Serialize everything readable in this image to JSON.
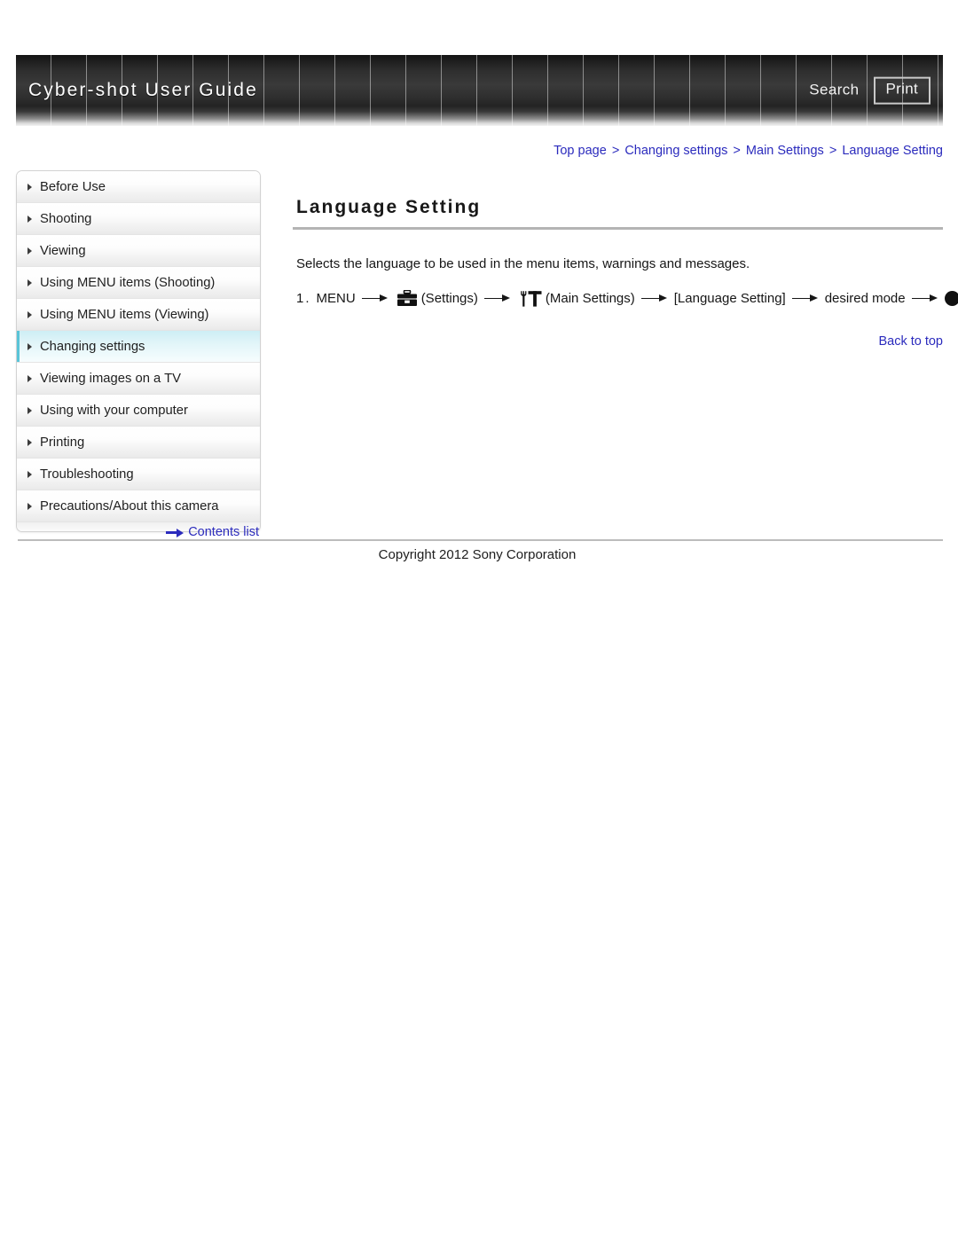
{
  "header": {
    "title": "Cyber-shot User Guide",
    "search_label": "Search",
    "print_label": "Print"
  },
  "breadcrumb": {
    "items": [
      "Top page",
      "Changing settings",
      "Main Settings",
      "Language Setting"
    ],
    "separator": ">"
  },
  "sidebar": {
    "items": [
      {
        "label": "Before Use",
        "active": false
      },
      {
        "label": "Shooting",
        "active": false
      },
      {
        "label": "Viewing",
        "active": false
      },
      {
        "label": "Using MENU items (Shooting)",
        "active": false
      },
      {
        "label": "Using MENU items (Viewing)",
        "active": false
      },
      {
        "label": "Changing settings",
        "active": true
      },
      {
        "label": "Viewing images on a TV",
        "active": false
      },
      {
        "label": "Using with your computer",
        "active": false
      },
      {
        "label": "Printing",
        "active": false
      },
      {
        "label": "Troubleshooting",
        "active": false
      },
      {
        "label": "Precautions/About this camera",
        "active": false
      }
    ],
    "contents_list_label": "Contents list"
  },
  "main": {
    "title": "Language Setting",
    "description": "Selects the language to be used in the menu items, warnings and messages.",
    "step": {
      "number": "1.",
      "menu_label": "MENU",
      "settings_label": "(Settings)",
      "main_settings_label": "(Main Settings)",
      "language_setting_label": "[Language Setting]",
      "desired_mode_label": "desired mode"
    },
    "back_to_top_label": "Back to top"
  },
  "footer": {
    "copyright": "Copyright 2012 Sony Corporation"
  },
  "colors": {
    "link": "#2b2bbd",
    "header_dark": "#2e2e2e",
    "sidebar_active": "#cdeef5",
    "rule": "#b4b4b4"
  }
}
